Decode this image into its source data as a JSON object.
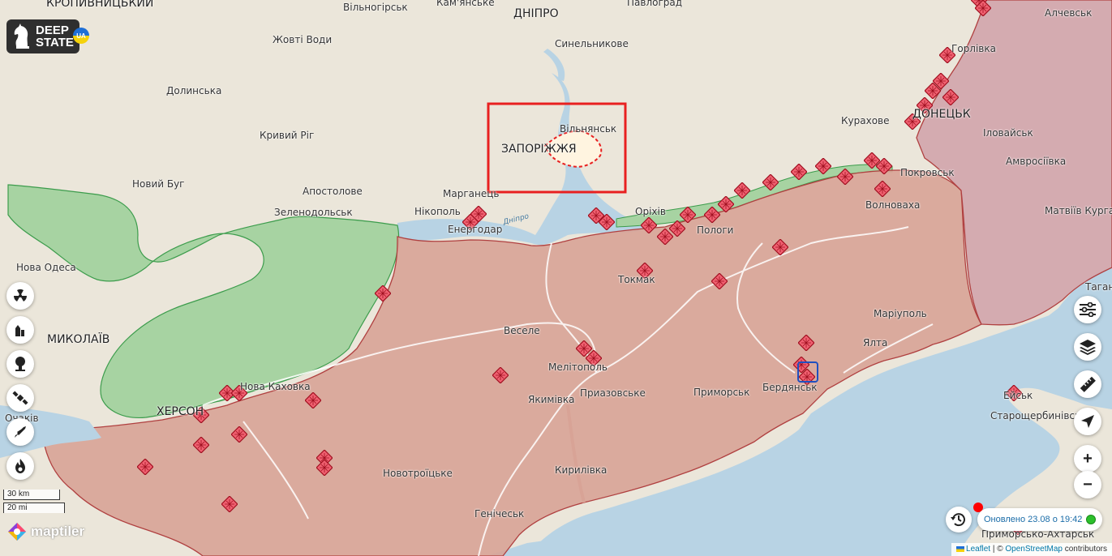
{
  "map": {
    "places": [
      {
        "name": "КРОПИВНИЦЬКИЙ",
        "kind": "city"
      },
      {
        "name": "Вільногірськ"
      },
      {
        "name": "Кам'янське"
      },
      {
        "name": "ДНІПРО",
        "kind": "city"
      },
      {
        "name": "Павлоград"
      },
      {
        "name": "Алчевськ"
      },
      {
        "name": "Жовті Води"
      },
      {
        "name": "Синельникове"
      },
      {
        "name": "Горлівка"
      },
      {
        "name": "Долинська"
      },
      {
        "name": "Вільнянськ"
      },
      {
        "name": "Курахове"
      },
      {
        "name": "ДОНЕЦЬК",
        "kind": "city"
      },
      {
        "name": "Іловайськ"
      },
      {
        "name": "Кривий Ріг"
      },
      {
        "name": "ЗАПОРІЖЖЯ",
        "kind": "city"
      },
      {
        "name": "Амвросіївка"
      },
      {
        "name": "Новий Буг"
      },
      {
        "name": "Апостолове"
      },
      {
        "name": "Марганець"
      },
      {
        "name": "Покровськ"
      },
      {
        "name": "Волноваха"
      },
      {
        "name": "Зеленодольськ"
      },
      {
        "name": "Нікополь"
      },
      {
        "name": "Енергодар"
      },
      {
        "name": "Оріхів"
      },
      {
        "name": "Пологи"
      },
      {
        "name": "Матвіїв Курган"
      },
      {
        "name": "Нова Одеса"
      },
      {
        "name": "Токмак"
      },
      {
        "name": "Таганрог"
      },
      {
        "name": "Маріуполь"
      },
      {
        "name": "МИКОЛАЇВ",
        "kind": "city"
      },
      {
        "name": "Веселе"
      },
      {
        "name": "Ялта"
      },
      {
        "name": "Мелітополь"
      },
      {
        "name": "Бердянськ"
      },
      {
        "name": "Нова Каховка"
      },
      {
        "name": "Приазовське"
      },
      {
        "name": "Приморськ"
      },
      {
        "name": "ХЕРСОН",
        "kind": "city"
      },
      {
        "name": "Якимівка"
      },
      {
        "name": "Очаків"
      },
      {
        "name": "Ейськ"
      },
      {
        "name": "Старощербинівська"
      },
      {
        "name": "Новотроїцьке"
      },
      {
        "name": "Кирилівка"
      },
      {
        "name": "Генічеськ"
      },
      {
        "name": "Приморсько-Ахтарськ"
      }
    ],
    "water_labels": [
      "Дніпро"
    ],
    "colors": {
      "land": "#ebe6da",
      "water": "#b8d3e4",
      "occupied": "#d8a396",
      "occupied_border": "#b04040",
      "liberated": "#a7d3a2",
      "liberated_border": "#3c9c4c",
      "marker": "#e8404a",
      "highlight": "#e82020"
    }
  },
  "branding": {
    "logo_line1": "DEEP",
    "logo_line2": "STATE",
    "ua_badge": "UA",
    "maptiler": "maptiler"
  },
  "scale": {
    "metric": "30 km",
    "imperial": "20 mi"
  },
  "left_tools": [
    {
      "icon": "radiation-icon"
    },
    {
      "icon": "fortress-icon"
    },
    {
      "icon": "explosion-icon"
    },
    {
      "icon": "satellite-icon"
    },
    {
      "icon": "rocket-icon"
    },
    {
      "icon": "fire-icon"
    }
  ],
  "right_tools": [
    {
      "icon": "filter-icon"
    },
    {
      "icon": "layers-icon"
    },
    {
      "icon": "ruler-icon"
    },
    {
      "icon": "locate-icon"
    }
  ],
  "zoom": {
    "in": "+",
    "out": "−"
  },
  "status": {
    "updated": "Оновлено 23.08 о 19:42"
  },
  "attribution": {
    "leaflet": "Leaflet",
    "sep": " | © ",
    "osm": "OpenStreetMap",
    "tail": " contributors"
  }
}
